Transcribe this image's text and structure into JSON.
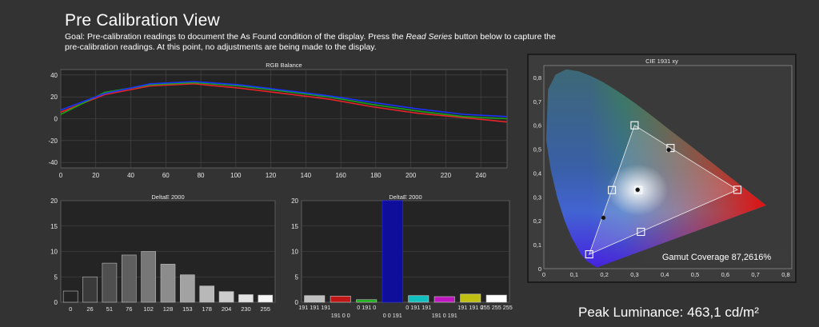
{
  "header": {
    "title": "Pre Calibration View",
    "goal_part1": "Goal: Pre-calibration readings to document the As Found condition of the display. Press the ",
    "goal_emphasis": "Read Series",
    "goal_part2": " button below to capture the pre-calibration readings. At this point, no adjustments are being made to the display."
  },
  "colors": {
    "background": "#333333",
    "plot_bg": "#242424",
    "red": "#e8232a",
    "green": "#19a319",
    "blue": "#1a33ff"
  },
  "chart_data": [
    {
      "type": "line",
      "title": "RGB Balance",
      "x": [
        0,
        25,
        51,
        76,
        102,
        128,
        153,
        178,
        204,
        230,
        255
      ],
      "xticks": [
        "0",
        "20",
        "40",
        "60",
        "80",
        "100",
        "120",
        "140",
        "160",
        "180",
        "200",
        "220",
        "240"
      ],
      "yticks": [
        "40",
        "20",
        "0",
        "-20",
        "-40"
      ],
      "xlim": [
        0,
        255
      ],
      "ylim": [
        -45,
        45
      ],
      "series": [
        {
          "color": "#e8232a",
          "values": [
            6,
            22,
            30,
            32,
            28,
            23,
            18,
            11,
            5,
            1,
            -3
          ]
        },
        {
          "color": "#19a319",
          "values": [
            4,
            24,
            31,
            33,
            30,
            25,
            20,
            13,
            7,
            2,
            0
          ]
        },
        {
          "color": "#1a33ff",
          "values": [
            8,
            23,
            32,
            34,
            31,
            26,
            21,
            15,
            9,
            4,
            2
          ]
        }
      ]
    },
    {
      "type": "bar",
      "title": "DeltaE 2000",
      "categories": [
        "0",
        "26",
        "51",
        "76",
        "102",
        "128",
        "153",
        "178",
        "204",
        "230",
        "255"
      ],
      "values": [
        2.2,
        5.0,
        7.7,
        9.3,
        10.0,
        7.5,
        5.4,
        3.2,
        2.1,
        1.5,
        1.4
      ],
      "colors": [
        "#242424",
        "#3a3a3a",
        "#4f4f4f",
        "#5f5f5f",
        "#777777",
        "#8c8c8c",
        "#a2a2a2",
        "#b8b8b8",
        "#cdcdcd",
        "#e3e3e3",
        "#f6f6f6"
      ],
      "yticks": [
        "20",
        "15",
        "10",
        "5",
        "0"
      ],
      "ylim": [
        0,
        20
      ]
    },
    {
      "type": "bar",
      "title": "DeltaE 2000",
      "values": [
        1.3,
        1.2,
        0.5,
        20.0,
        1.3,
        1.1,
        0.9,
        1.6,
        1.4
      ],
      "colors": [
        "#bfbfbf",
        "#c11616",
        "#16b016",
        "#0e0e9a",
        "#12bfbf",
        "#c016c0",
        "#bfbf12",
        "#ffffff"
      ],
      "labels_top": [
        "191 191 191",
        "0 191 0",
        "0 191 191",
        "191 191 0",
        "255 255 255"
      ],
      "labels_bottom": [
        "191 0 0",
        "0 0 191",
        "191 0 191"
      ],
      "yticks": [
        "20",
        "15",
        "10",
        "5",
        "0"
      ],
      "ylim": [
        0,
        20
      ]
    },
    {
      "type": "scatter",
      "title": "CIE 1931 xy",
      "xticks": [
        "0",
        "0,1",
        "0,2",
        "0,3",
        "0,4",
        "0,5",
        "0,6",
        "0,7",
        "0,8"
      ],
      "yticks": [
        "0,8",
        "0,7",
        "0,6",
        "0,5",
        "0,4",
        "0,3",
        "0,2",
        "0,1",
        "0"
      ],
      "xlim": [
        0,
        0.82
      ],
      "ylim": [
        0,
        0.85
      ],
      "gamut": [
        [
          0.64,
          0.33
        ],
        [
          0.3,
          0.6
        ],
        [
          0.15,
          0.06
        ]
      ],
      "targets": [
        [
          0.64,
          0.33
        ],
        [
          0.3,
          0.6
        ],
        [
          0.15,
          0.06
        ],
        [
          0.225,
          0.329
        ],
        [
          0.419,
          0.505
        ],
        [
          0.321,
          0.154
        ],
        [
          0.3127,
          0.329
        ]
      ],
      "measured": [
        [
          0.413,
          0.497
        ],
        [
          0.197,
          0.213
        ],
        [
          0.31,
          0.33
        ]
      ],
      "annotation_label": "Gamut Coverage",
      "annotation_value": "87,2616%"
    }
  ],
  "footer": {
    "peak_label": "Peak Luminance:",
    "peak_value": "463,1 cd/m²"
  }
}
